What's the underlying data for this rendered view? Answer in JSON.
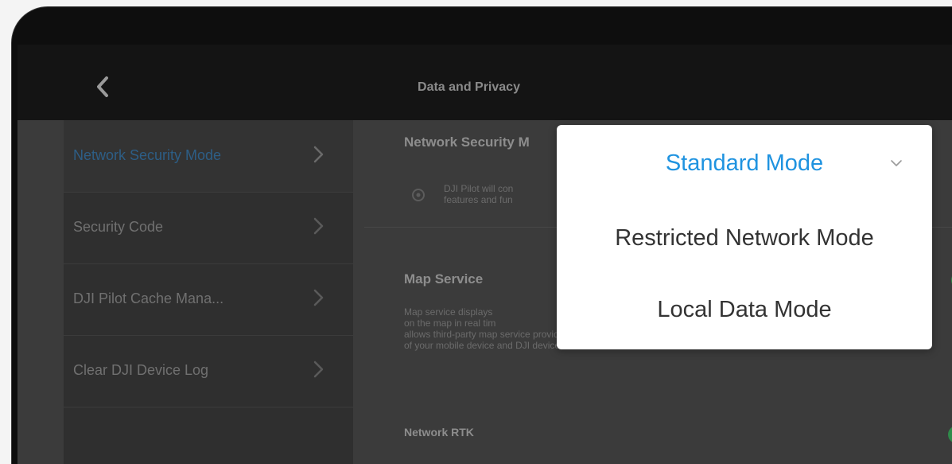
{
  "header": {
    "title": "Data and Privacy",
    "back_icon": "back-chevron-icon"
  },
  "sidebar": {
    "items": [
      {
        "label": "Network Security Mode",
        "active": true
      },
      {
        "label": "Security Code",
        "active": false
      },
      {
        "label": "DJI Pilot Cache Mana...",
        "active": false
      },
      {
        "label": "Clear DJI Device Log",
        "active": false
      }
    ]
  },
  "content": {
    "network_security": {
      "title": "Network Security M",
      "desc_line1": "DJI Pilot will con",
      "desc_line2": "features and fun"
    },
    "map_service": {
      "title": "Map Service",
      "desc_line1": "Map service displays",
      "desc_line2": "on the map in real tim",
      "desc_line3": "allows third-party map service providers to access the location informati",
      "desc_line4": "of your mobile device and DJI devices."
    },
    "network_rtk": {
      "title": "Network RTK"
    }
  },
  "dropdown": {
    "options": [
      {
        "label": "Standard Mode",
        "selected": true
      },
      {
        "label": "Restricted Network Mode",
        "selected": false
      },
      {
        "label": "Local Data Mode",
        "selected": false
      }
    ]
  },
  "colors": {
    "accent": "#1f93e0",
    "toggle_on": "#2f8a4a",
    "active_sidebar_text": "#2d5e86"
  }
}
